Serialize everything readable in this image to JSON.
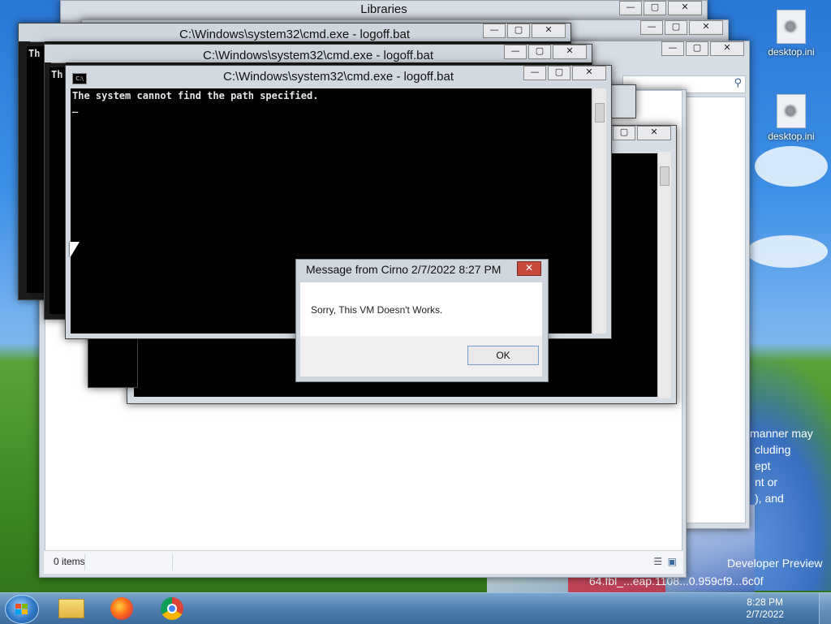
{
  "desktop": {
    "icons": [
      {
        "label": "desktop.ini"
      },
      {
        "label": "desktop.ini"
      }
    ],
    "watermark": {
      "lines": [
        "manner may",
        "cluding",
        "ept",
        "nt or",
        "), and"
      ],
      "build_line1": "Developer Preview",
      "build_line2": "64.fbl_...eap.1108...0.959cf9...6c0f"
    }
  },
  "explorer": {
    "title": "Libraries",
    "status": "0 items"
  },
  "cmd_windows": [
    {
      "title": "C:\\Windows\\system32\\cmd.exe - logoff.bat",
      "snippet": "Th"
    },
    {
      "title": "C:\\Windows\\system32\\cmd.exe - logoff.bat",
      "snippet": "Th"
    },
    {
      "title": "C:\\Windows\\system32\\cmd.exe - logoff.bat",
      "output": "The system cannot find the path specified.",
      "cursor": "_"
    }
  ],
  "message_box": {
    "title": "Message from Cirno 2/7/2022 8:27 PM",
    "text": "Sorry, This VM Doesn't Works.",
    "ok_label": "OK",
    "close_label": "✕"
  },
  "window_controls": {
    "minimize": "—",
    "maximize": "▢",
    "close": "✕"
  },
  "taskbar": {
    "clock_time": "8:28 PM",
    "clock_date": "2/7/2022",
    "apps": [
      "file-explorer",
      "firefox",
      "chrome"
    ]
  }
}
